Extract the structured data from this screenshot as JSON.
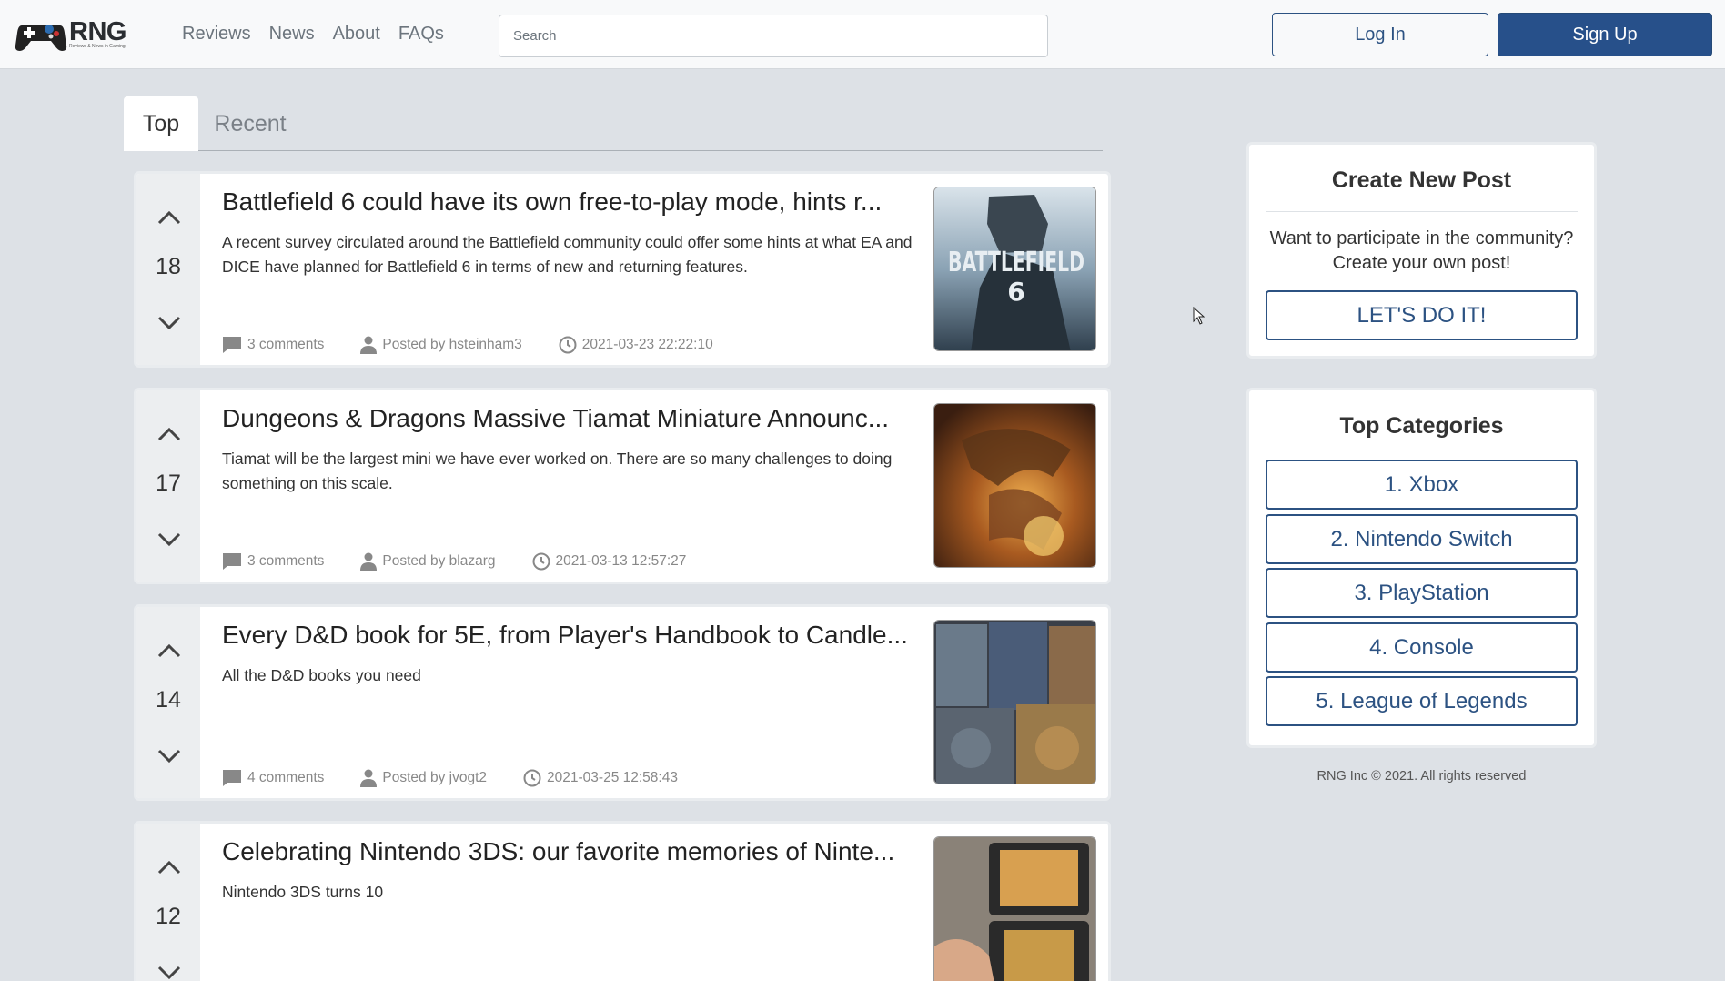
{
  "nav": {
    "logo_text": "RNG",
    "logo_tagline": "Reviews & News in Gaming",
    "links": [
      "Reviews",
      "News",
      "About",
      "FAQs"
    ],
    "search_placeholder": "Search",
    "login_label": "Log In",
    "signup_label": "Sign Up"
  },
  "tabs": [
    "Top",
    "Recent"
  ],
  "active_tab": "Top",
  "posts": [
    {
      "votes": "18",
      "title": "Battlefield 6 could have its own free-to-play mode, hints r...",
      "description": "A recent survey circulated around the Battlefield community could offer some hints at what EA and DICE have planned for Battlefield 6 in terms of new and returning features.",
      "comments": "3 comments",
      "author": "Posted by hsteinham3",
      "date": "2021-03-23 22:22:10",
      "thumb_text": "BATTLEFIELD",
      "thumb_sub": "6"
    },
    {
      "votes": "17",
      "title": "Dungeons & Dragons Massive Tiamat Miniature Announc...",
      "description": "Tiamat will be the largest mini we have ever worked on. There are so many challenges to doing something on this scale.",
      "comments": "3 comments",
      "author": "Posted by blazarg",
      "date": "2021-03-13 12:57:27"
    },
    {
      "votes": "14",
      "title": "Every D&D book for 5E, from Player's Handbook to Candle...",
      "description": "All the D&D books you need",
      "comments": "4 comments",
      "author": "Posted by jvogt2",
      "date": "2021-03-25 12:58:43"
    },
    {
      "votes": "12",
      "title": "Celebrating Nintendo 3DS: our favorite memories of Ninte...",
      "description": "Nintendo 3DS turns 10"
    }
  ],
  "sidebar": {
    "create_post": {
      "title": "Create New Post",
      "text": "Want to participate in the community? Create your own post!",
      "button": "LET'S DO IT!"
    },
    "top_categories": {
      "title": "Top Categories",
      "items": [
        "1. Xbox",
        "2. Nintendo Switch",
        "3. PlayStation",
        "4. Console",
        "5. League of Legends"
      ]
    },
    "footer": "RNG Inc © 2021. All rights reserved"
  },
  "colors": {
    "page_bg": "#dde1e6",
    "accent": "#2c5282",
    "signup_bg": "#27508a"
  }
}
